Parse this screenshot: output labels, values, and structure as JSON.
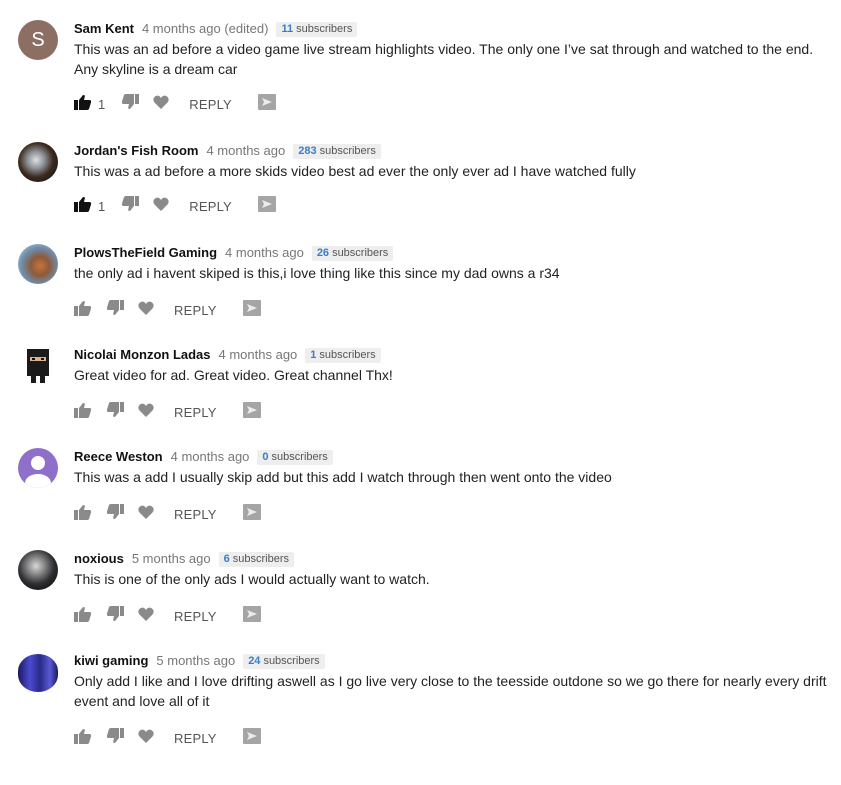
{
  "comments": [
    {
      "author": "Sam Kent",
      "avatar_letter": "S",
      "time": "4 months ago (edited)",
      "subs_num": "11",
      "subs_label": "subscribers",
      "text": "This was an ad before a video game live stream highlights video. The only one I’ve sat through and watched to the end. Any skyline is a dream car",
      "likes": "1",
      "reply": "REPLY"
    },
    {
      "author": "Jordan's Fish Room",
      "time": "4 months ago",
      "subs_num": "283",
      "subs_label": "subscribers",
      "text": "This was a ad before a more skids video best ad ever the only ever ad I have watched fully",
      "likes": "1",
      "reply": "REPLY"
    },
    {
      "author": "PlowsTheField Gaming",
      "time": "4 months ago",
      "subs_num": "26",
      "subs_label": "subscribers",
      "text": "the only ad i havent skiped is this,i love thing like this since my dad owns a r34",
      "likes": "",
      "reply": "REPLY"
    },
    {
      "author": "Nicolai Monzon Ladas",
      "time": "4 months ago",
      "subs_num": "1",
      "subs_label": "subscribers",
      "text": "Great video for ad. Great video. Great channel Thx!",
      "likes": "",
      "reply": "REPLY"
    },
    {
      "author": "Reece Weston",
      "time": "4 months ago",
      "subs_num": "0",
      "subs_label": "subscribers",
      "text": "This was a add I usually skip add but this add I watch through then went onto the video",
      "likes": "",
      "reply": "REPLY"
    },
    {
      "author": "noxious",
      "time": "5 months ago",
      "subs_num": "6",
      "subs_label": "subscribers",
      "text": "This is one of the only ads I would actually want to watch.",
      "likes": "",
      "reply": "REPLY"
    },
    {
      "author": "kiwi gaming",
      "time": "5 months ago",
      "subs_num": "24",
      "subs_label": "subscribers",
      "text": "Only add I like and I love drifting aswell as I go live very close to the teesside outdone so we go there for nearly every drift event and love all of it",
      "likes": "",
      "reply": "REPLY"
    }
  ],
  "colors": {
    "accent": "#3a7ec7",
    "liked": "#111111",
    "muted": "#8a8a8a"
  }
}
